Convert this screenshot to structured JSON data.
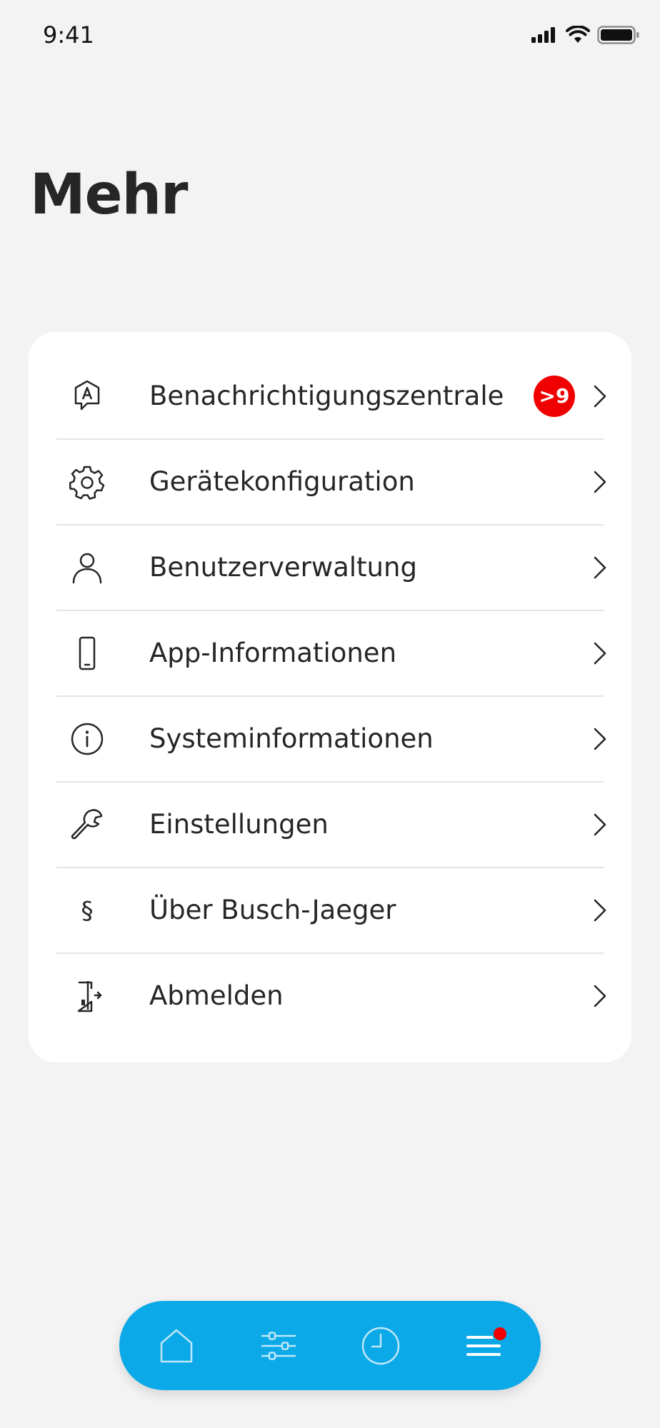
{
  "status_bar": {
    "time": "9:41"
  },
  "header": {
    "title": "Mehr"
  },
  "menu": {
    "items": [
      {
        "label": "Benachrichtigungszentrale",
        "icon": "notification-a-icon",
        "badge": ">9"
      },
      {
        "label": "Gerätekonfiguration",
        "icon": "gear-icon"
      },
      {
        "label": "Benutzerverwaltung",
        "icon": "user-icon"
      },
      {
        "label": "App-Informationen",
        "icon": "smartphone-icon"
      },
      {
        "label": "Systeminformationen",
        "icon": "info-icon"
      },
      {
        "label": "Einstellungen",
        "icon": "wrench-icon"
      },
      {
        "label": "Über Busch-Jaeger",
        "icon": "paragraph-icon",
        "glyph": "§"
      },
      {
        "label": "Abmelden",
        "icon": "logout-door-icon"
      }
    ]
  },
  "tab_bar": {
    "tabs": [
      {
        "icon": "home-icon",
        "active": false
      },
      {
        "icon": "sliders-icon",
        "active": false
      },
      {
        "icon": "clock-icon",
        "active": false
      },
      {
        "icon": "menu-icon",
        "active": true,
        "notification_dot": true
      }
    ]
  },
  "colors": {
    "background": "#f3f3f3",
    "card": "#ffffff",
    "accent": "#0ba9e8",
    "badge": "#f00000",
    "text": "#262626"
  }
}
